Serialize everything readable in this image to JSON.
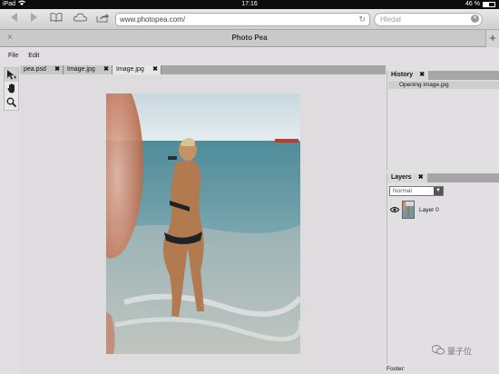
{
  "statusbar": {
    "device": "iPad",
    "time": "17:16",
    "battery": "46 %"
  },
  "safari": {
    "url": "www.photopea.com/",
    "search_placeholder": "Hledat",
    "tab_title": "Photo Pea",
    "new_tab": "+",
    "close_tab": "×"
  },
  "menu": {
    "file": "File",
    "edit": "Edit"
  },
  "document_tabs": [
    {
      "label": "pea.psd",
      "close": "✖"
    },
    {
      "label": "Image.jpg",
      "close": "✖"
    },
    {
      "label": "Image.jpg",
      "close": "✖"
    }
  ],
  "history_panel": {
    "title": "History",
    "close": "✖",
    "items": [
      "Opening image.jpg"
    ]
  },
  "layers_panel": {
    "title": "Layers",
    "close": "✖",
    "blend_mode": "Normal",
    "layers": [
      {
        "name": "Layer 0",
        "visible": true
      }
    ]
  },
  "footer_label": "Footer:",
  "watermark": "量子位",
  "icons": {
    "back": "back-arrow-icon",
    "forward": "forward-arrow-icon",
    "bookmarks": "book-icon",
    "cloud": "cloud-icon",
    "share": "share-icon",
    "reload": "reload-icon",
    "move_tool": "move-tool-icon",
    "hand_tool": "hand-tool-icon",
    "zoom_tool": "zoom-tool-icon",
    "eye": "eye-icon"
  }
}
